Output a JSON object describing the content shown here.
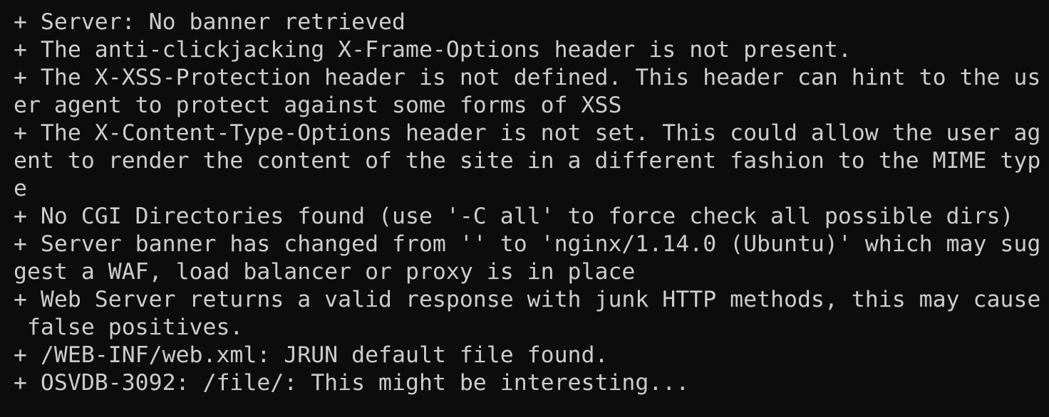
{
  "terminal": {
    "lines": [
      "+ Server: No banner retrieved",
      "+ The anti-clickjacking X-Frame-Options header is not present.",
      "+ The X-XSS-Protection header is not defined. This header can hint to the us",
      "er agent to protect against some forms of XSS",
      "+ The X-Content-Type-Options header is not set. This could allow the user ag",
      "ent to render the content of the site in a different fashion to the MIME typ",
      "e",
      "+ No CGI Directories found (use '-C all' to force check all possible dirs)",
      "+ Server banner has changed from '' to 'nginx/1.14.0 (Ubuntu)' which may sug",
      "gest a WAF, load balancer or proxy is in place",
      "+ Web Server returns a valid response with junk HTTP methods, this may cause",
      " false positives.",
      "+ /WEB-INF/web.xml: JRUN default file found.",
      "+ OSVDB-3092: /file/: This might be interesting..."
    ]
  },
  "colors": {
    "background": "#0c0c0c",
    "foreground": "#cccccc"
  }
}
